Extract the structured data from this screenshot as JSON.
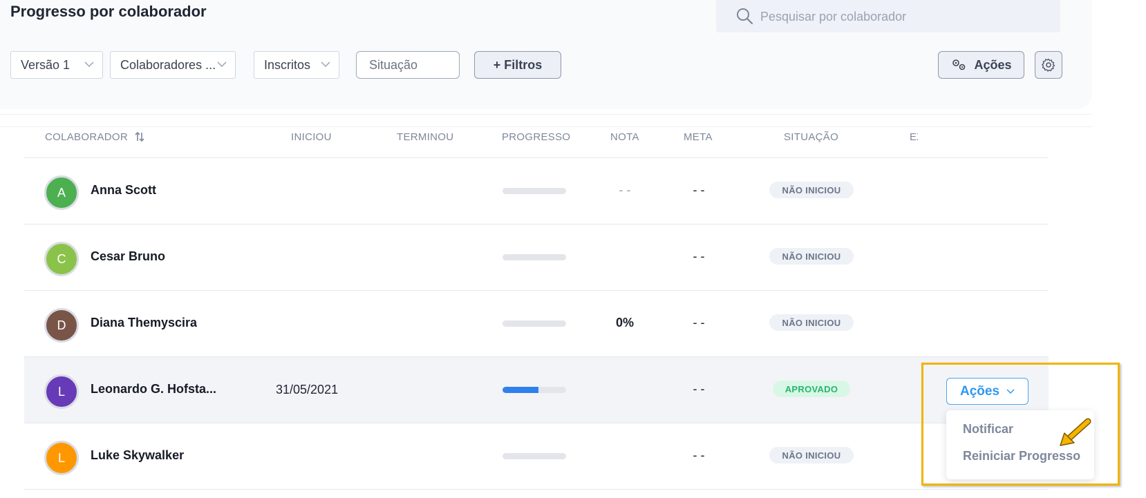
{
  "header": {
    "title": "Progresso por colaborador",
    "search_placeholder": "Pesquisar por colaborador"
  },
  "filters": {
    "version": "Versão 1",
    "colaboradores": "Colaboradores ...",
    "inscritos": "Inscritos",
    "situacao_placeholder": "Situação",
    "more_filters": "+ Filtros",
    "actions": "Ações"
  },
  "table": {
    "columns": [
      "COLABORADOR",
      "INICIOU",
      "TERMINOU",
      "PROGRESSO",
      "NOTA",
      "META",
      "SITUAÇÃO",
      "EX"
    ],
    "rows": [
      {
        "initial": "A",
        "name": "Anna Scott",
        "started": "",
        "finished": "",
        "progress": 0,
        "nota": "- -",
        "meta": "- -",
        "status": "NÃO INICIOU",
        "avatar_color": "#4caf50"
      },
      {
        "initial": "C",
        "name": "Cesar Bruno",
        "started": "",
        "finished": "",
        "progress": 0,
        "nota": "",
        "meta": "- -",
        "status": "NÃO INICIOU",
        "avatar_color": "#8bc34a"
      },
      {
        "initial": "D",
        "name": "Diana Themyscira",
        "started": "",
        "finished": "",
        "progress": 0,
        "nota": "0%",
        "meta": "- -",
        "status": "NÃO INICIOU",
        "avatar_color": "#795548"
      },
      {
        "initial": "L",
        "name": "Leonardo G. Hofsta...",
        "started": "31/05/2021",
        "finished": "",
        "progress": 0.57,
        "nota": "",
        "meta": "- -",
        "status": "APROVADO",
        "avatar_color": "#673ab7"
      },
      {
        "initial": "L",
        "name": "Luke Skywalker",
        "started": "",
        "finished": "",
        "progress": 0,
        "nota": "",
        "meta": "- -",
        "status": "NÃO INICIOU",
        "avatar_color": "#ff9800"
      }
    ]
  },
  "row_actions": {
    "button": "Ações",
    "menu": [
      "Notificar",
      "Reiniciar Progresso"
    ]
  },
  "colors": {
    "accent": "#2f98ee",
    "highlight_border": "#f0b400",
    "approved": "#27b56a"
  }
}
